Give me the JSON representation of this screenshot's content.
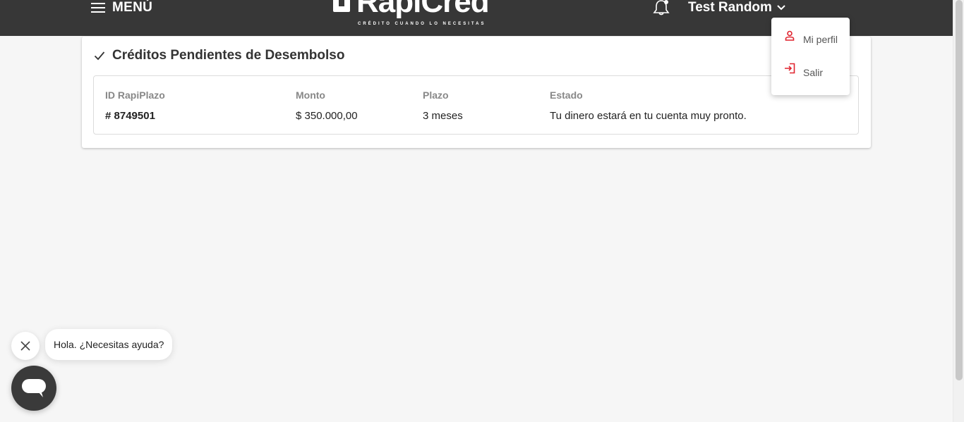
{
  "header": {
    "menu_label": "MENÚ",
    "logo_text": "RapiCredit",
    "logo_tagline": "CRÉDITO CUANDO LO NECESITAS",
    "user_name": "Test Random"
  },
  "dropdown": {
    "items": [
      {
        "label": "Mi perfil",
        "icon": "user-icon"
      },
      {
        "label": "Salir",
        "icon": "logout-icon"
      }
    ]
  },
  "card": {
    "title": "Créditos Pendientes de Desembolso",
    "columns": [
      "ID RapiPlazo",
      "Monto",
      "Plazo",
      "Estado"
    ],
    "row": {
      "id": "# 8749501",
      "monto": "$ 350.000,00",
      "plazo": "3 meses",
      "estado": "Tu dinero estará en tu cuenta muy pronto."
    }
  },
  "chat": {
    "message": "Hola. ¿Necesitas ayuda?"
  },
  "colors": {
    "header_bg": "#373737",
    "accent_red": "#e0242f",
    "page_bg": "#f6f6f6"
  }
}
